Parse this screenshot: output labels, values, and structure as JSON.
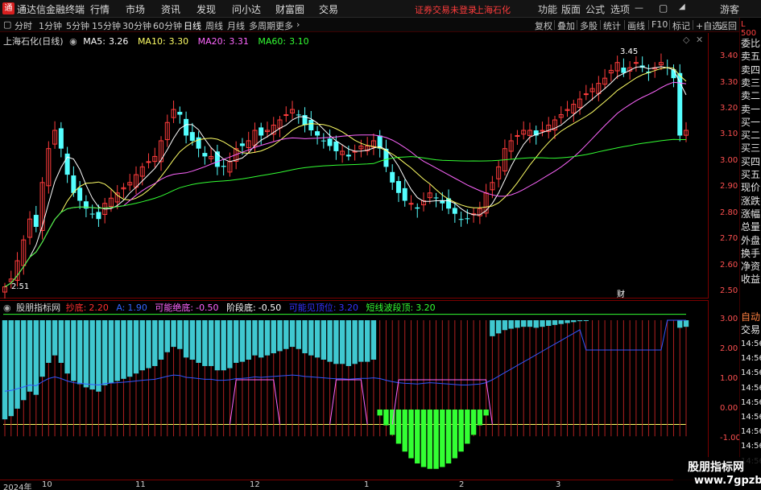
{
  "app": {
    "logo": "通",
    "title": "通达信金融终端"
  },
  "menu": [
    "行情",
    "市场",
    "资讯",
    "发现",
    "问小达",
    "财富圈",
    "交易"
  ],
  "status": {
    "login": "证券交易未登录",
    "stock": "上海石化"
  },
  "window_menu": [
    "功能",
    "版面",
    "公式",
    "选项",
    "游客"
  ],
  "toolbar": {
    "periods": [
      "分时",
      "1分钟",
      "5分钟",
      "15分钟",
      "30分钟",
      "60分钟",
      "日线",
      "周线",
      "月线",
      "多周期",
      "更多"
    ],
    "active_period": "日线",
    "tools": [
      "复权",
      "叠加",
      "多股",
      "统计",
      "画线",
      "F10",
      "标记",
      "+自选",
      "返回"
    ]
  },
  "main_chart": {
    "name": "上海石化(日线)",
    "ma": [
      {
        "label": "MA5:",
        "value": "3.26",
        "color": "#ffffff"
      },
      {
        "label": "MA10:",
        "value": "3.30",
        "color": "#ffff66"
      },
      {
        "label": "MA20:",
        "value": "3.31",
        "color": "#ff66ff"
      },
      {
        "label": "MA60:",
        "value": "3.10",
        "color": "#33ff33"
      }
    ],
    "high_label": "3.45",
    "low_label": "2.51",
    "event_marker": "财",
    "price_ticks": [
      "3.40",
      "3.30",
      "3.20",
      "3.10",
      "3.00",
      "2.90",
      "2.80",
      "2.70",
      "2.60",
      "2.50"
    ]
  },
  "sub_chart": {
    "name": "股朋指标网",
    "items": [
      {
        "label": "抄底:",
        "value": "2.20",
        "color": "#ff3030"
      },
      {
        "label": "A:",
        "value": "1.90",
        "color": "#3366ff"
      },
      {
        "label": "可能绝底:",
        "value": "-0.50",
        "color": "#ff66ff"
      },
      {
        "label": "阶段底:",
        "value": "-0.50",
        "color": "#ffffff"
      },
      {
        "label": "可能见顶位:",
        "value": "3.20",
        "color": "#3333ff"
      },
      {
        "label": "短线波段顶:",
        "value": "3.20",
        "color": "#33ff33"
      }
    ],
    "ticks": [
      "3.00",
      "2.00",
      "1.00",
      "0.00",
      "-1.00"
    ]
  },
  "date_axis": [
    "2024年",
    "10",
    "11",
    "12",
    "1",
    "2",
    "3"
  ],
  "quote_panel": {
    "header": "L 500",
    "items": [
      "委比",
      "卖五",
      "卖四",
      "卖三",
      "卖二",
      "卖一",
      "买一",
      "买二",
      "买三",
      "买四",
      "买五",
      "现价",
      "涨跌",
      "涨幅",
      "总量",
      "外盘",
      "换手",
      "净资",
      "收益",
      "自动",
      "交易",
      "14:56",
      "14:56",
      "14:56",
      "14:56",
      "14:56",
      "14:56",
      "14:56",
      "14:56",
      "14:56"
    ]
  },
  "watermark": {
    "line1": "股朋指标网",
    "line2": "www.7gpzb.com"
  },
  "chart_data": {
    "type": "candlestick",
    "y_range": [
      2.5,
      3.45
    ],
    "x_months": [
      "10",
      "11",
      "12",
      "1",
      "2",
      "3"
    ],
    "high": 3.45,
    "low": 2.51,
    "ma_last": {
      "MA5": 3.26,
      "MA10": 3.3,
      "MA20": 3.31,
      "MA60": 3.1
    },
    "close_path": [
      2.52,
      2.55,
      2.62,
      2.7,
      2.78,
      2.75,
      2.92,
      3.05,
      3.12,
      3.05,
      2.95,
      2.88,
      2.85,
      2.82,
      2.8,
      2.78,
      2.84,
      2.86,
      2.88,
      2.9,
      2.92,
      2.95,
      2.98,
      3.0,
      3.02,
      3.08,
      3.15,
      3.2,
      3.18,
      3.1,
      3.08,
      3.05,
      3.02,
      3.02,
      2.98,
      2.98,
      3.0,
      3.05,
      3.06,
      3.08,
      3.12,
      3.1,
      3.12,
      3.14,
      3.16,
      3.18,
      3.2,
      3.18,
      3.14,
      3.12,
      3.1,
      3.08,
      3.06,
      3.04,
      3.04,
      3.02,
      3.04,
      3.06,
      3.06,
      3.08,
      3.05,
      2.98,
      2.92,
      2.88,
      2.85,
      2.84,
      2.82,
      2.85,
      2.88,
      2.86,
      2.84,
      2.82,
      2.8,
      2.78,
      2.78,
      2.8,
      2.82,
      2.88,
      2.92,
      2.98,
      3.05,
      3.08,
      3.1,
      3.12,
      3.12,
      3.1,
      3.12,
      3.14,
      3.16,
      3.18,
      3.2,
      3.22,
      3.24,
      3.26,
      3.28,
      3.3,
      3.32,
      3.35,
      3.38,
      3.34,
      3.36,
      3.38,
      3.36,
      3.34,
      3.36,
      3.38,
      3.36,
      3.32,
      3.1,
      3.12
    ],
    "sub_indicator_ticks": [
      3.0,
      2.0,
      1.0,
      0.0,
      -1.0
    ]
  }
}
